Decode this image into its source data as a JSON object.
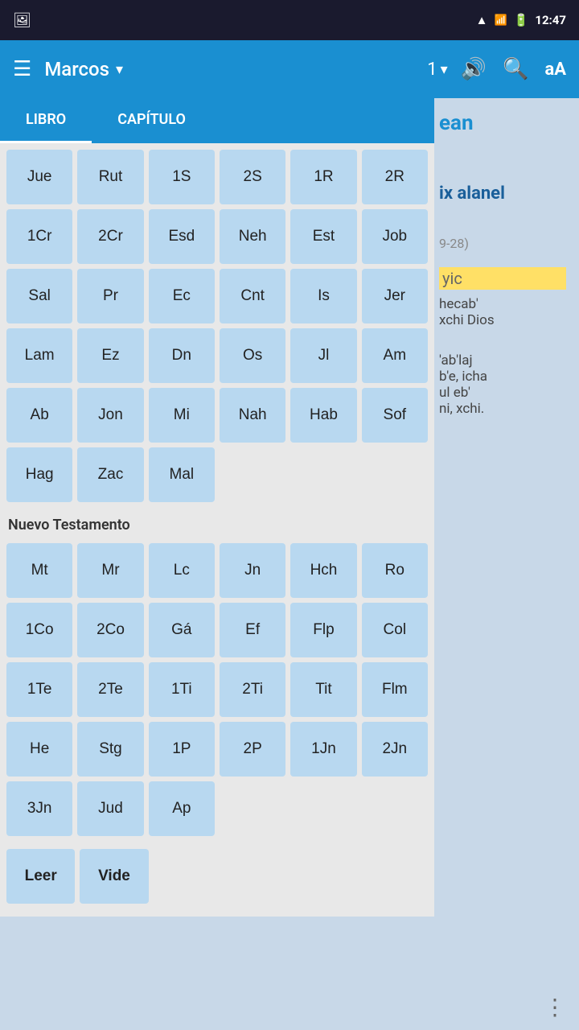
{
  "statusBar": {
    "time": "12:47",
    "icons": [
      "wifi",
      "signal",
      "battery"
    ]
  },
  "appBar": {
    "menuLabel": "☰",
    "bookTitle": "Marcos",
    "chapterNum": "1",
    "chevron": "▾",
    "soundIcon": "🔊",
    "searchIcon": "🔍",
    "fontIcon": "aA"
  },
  "tabs": {
    "libro": "LIBRO",
    "capitulo": "CAPÍTULO"
  },
  "oldTestament": {
    "rows": [
      [
        "Jue",
        "Rut",
        "1S",
        "2S",
        "1R",
        "2R"
      ],
      [
        "1Cr",
        "2Cr",
        "Esd",
        "Neh",
        "Est",
        "Job"
      ],
      [
        "Sal",
        "Pr",
        "Ec",
        "Cnt",
        "Is",
        "Jer"
      ],
      [
        "Lam",
        "Ez",
        "Dn",
        "Os",
        "Jl",
        "Am"
      ],
      [
        "Ab",
        "Jon",
        "Mi",
        "Nah",
        "Hab",
        "Sof"
      ],
      [
        "Hag",
        "Zac",
        "Mal",
        "",
        "",
        ""
      ]
    ]
  },
  "newTestamentTitle": "Nuevo Testamento",
  "newTestament": {
    "rows": [
      [
        "Mt",
        "Mr",
        "Lc",
        "Jn",
        "Hch",
        "Ro"
      ],
      [
        "1Co",
        "2Co",
        "Gá",
        "Ef",
        "Flp",
        "Col"
      ],
      [
        "1Te",
        "2Te",
        "1Ti",
        "2Ti",
        "Tit",
        "Flm"
      ],
      [
        "He",
        "Stg",
        "1P",
        "2P",
        "1Jn",
        "2Jn"
      ],
      [
        "3Jn",
        "Jud",
        "Ap",
        "",
        "",
        ""
      ]
    ]
  },
  "actions": {
    "leer": "Leer",
    "vide": "Vide"
  },
  "bgContent": {
    "title1": "ean",
    "title2": "ix alanel",
    "italic": "9-28)",
    "highlight": "yic",
    "text1": "hecab'",
    "text2": "xchi Dios",
    "text3": "'ab'laj",
    "text4": "b'e, icha",
    "text5": "ul eb'",
    "text6": "ni, xchi."
  }
}
